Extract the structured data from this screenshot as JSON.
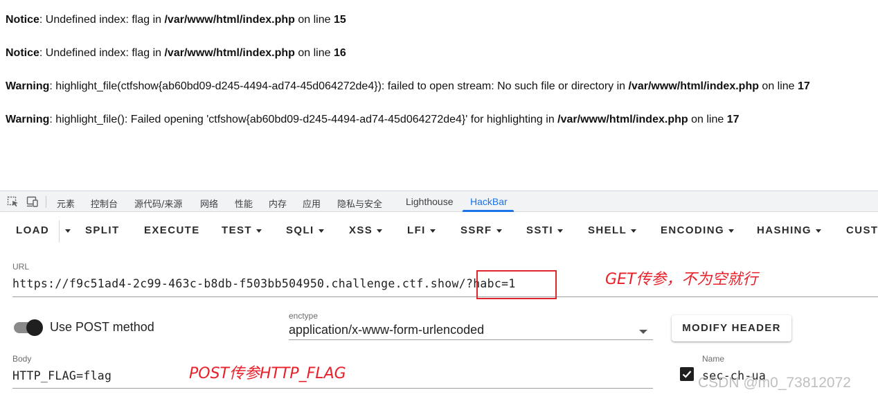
{
  "php_output": [
    {
      "level": "Notice",
      "text1": ": Undefined index: flag in ",
      "path": "/var/www/html/index.php",
      "text2": " on line ",
      "line": "15"
    },
    {
      "level": "Notice",
      "text1": ": Undefined index: flag in ",
      "path": "/var/www/html/index.php",
      "text2": " on line ",
      "line": "16"
    },
    {
      "level": "Warning",
      "text1": ": highlight_file(ctfshow{ab60bd09-d245-4494-ad74-45d064272de4}): failed to open stream: No such file or directory in ",
      "path": "/var/www/html/index.php",
      "text2": " on line ",
      "line": "17"
    },
    {
      "level": "Warning",
      "text1": ": highlight_file(): Failed opening 'ctfshow{ab60bd09-d245-4494-ad74-45d064272de4}' for highlighting in ",
      "path": "/var/www/html/index.php",
      "text2": " on line ",
      "line": "17"
    }
  ],
  "devtools": {
    "icons": [
      "inspect-element-icon",
      "device-toolbar-icon"
    ],
    "tabs": [
      "元素",
      "控制台",
      "源代码/来源",
      "网络",
      "性能",
      "内存",
      "应用",
      "隐私与安全",
      "Lighthouse",
      "HackBar"
    ],
    "active_tab": "HackBar",
    "accent_color": "#1a73e8"
  },
  "hackbar": {
    "toolbar": [
      "LOAD",
      "SPLIT",
      "EXECUTE",
      "TEST",
      "SQLI",
      "XSS",
      "LFI",
      "SSRF",
      "SSTI",
      "SHELL",
      "ENCODING",
      "HASHING",
      "CUSTO"
    ],
    "url_label": "URL",
    "url_value": "https://f9c51ad4-2c99-463c-b8db-f503bb504950.challenge.ctf.show/?habc=1",
    "use_post_label": "Use POST method",
    "use_post_enabled": true,
    "enctype_label": "enctype",
    "enctype_value": "application/x-www-form-urlencoded",
    "modify_header_label": "MODIFY HEADER",
    "body_label": "Body",
    "body_value": "HTTP_FLAG=flag",
    "header_name_label": "Name",
    "header_name_value": "sec-ch-ua",
    "header_checked": true
  },
  "annotations": {
    "get_note": "GET传参，不为空就行",
    "post_note": "POST传参HTTP_FLAG",
    "color": "#e8202a"
  },
  "watermark": "CSDN @m0_73812072"
}
